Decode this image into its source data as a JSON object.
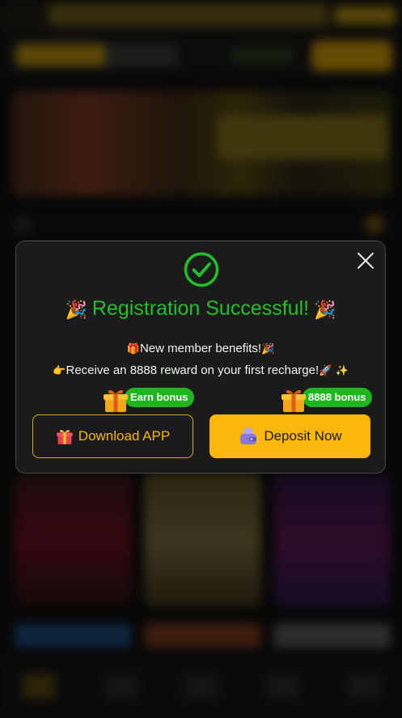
{
  "modal": {
    "title": "Registration Successful!",
    "title_left_emoji": "🎉",
    "title_right_emoji": "🎉",
    "benefits_line_prefix": "🎁",
    "benefits_text": "New member benefits!",
    "benefits_line_suffix": "🎉",
    "reward_line_prefix": "👉",
    "reward_text": "Receive an 8888 reward on your first recharge!",
    "reward_line_suffix_1": "🚀",
    "reward_line_suffix_2": "✨",
    "download_button_label": "Download APP",
    "download_badge": "Earn bonus",
    "deposit_button_label": "Deposit Now",
    "deposit_badge": "8888 bonus"
  },
  "colors": {
    "success_green": "#22c02a",
    "badge_green": "#1fb51f",
    "accent_gold": "#fcb70b",
    "modal_bg": "#1b1b1b"
  },
  "icons": {
    "success": "check-circle-icon",
    "close": "close-icon",
    "gift": "gift-icon",
    "wallet": "wallet-icon"
  }
}
